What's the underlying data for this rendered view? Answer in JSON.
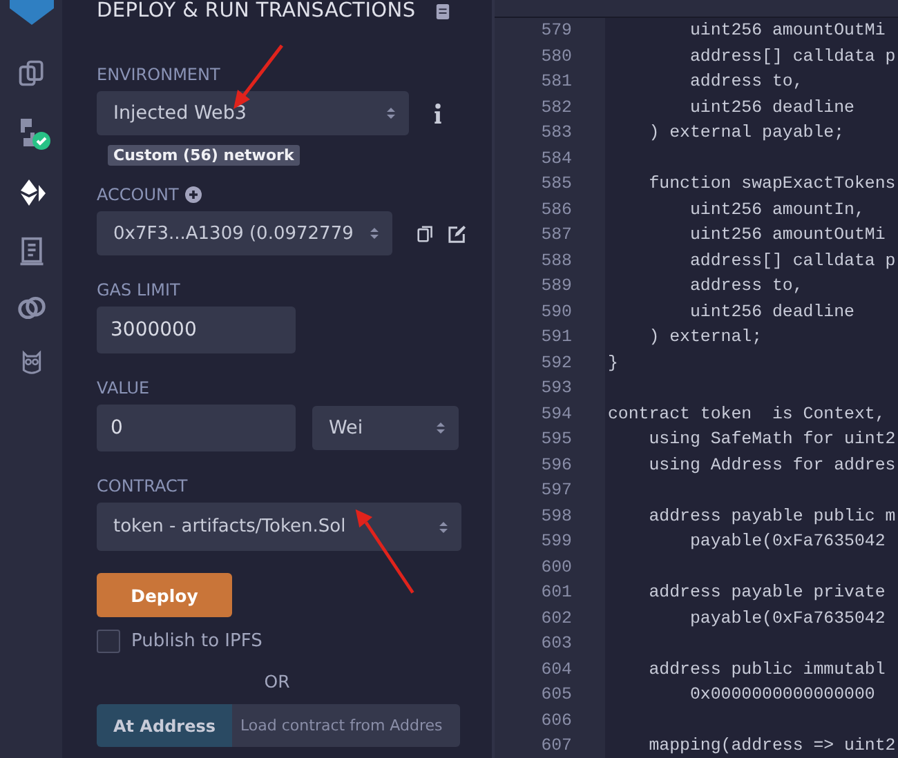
{
  "sidebar": {
    "items": [
      {
        "kind": "files",
        "selected": false
      },
      {
        "kind": "compiler",
        "selected": false,
        "badge": true
      },
      {
        "kind": "deploy",
        "selected": true
      },
      {
        "kind": "verify",
        "selected": false
      },
      {
        "kind": "link",
        "selected": false
      },
      {
        "kind": "owl",
        "selected": false
      }
    ]
  },
  "panel": {
    "title": "DEPLOY & RUN TRANSACTIONS",
    "environment": {
      "label": "ENVIRONMENT",
      "value": "Injected Web3",
      "network": "Custom (56) network"
    },
    "account": {
      "label": "ACCOUNT",
      "value": "0x7F3...A1309 (0.0972779"
    },
    "gas_limit": {
      "label": "GAS LIMIT",
      "value": "3000000"
    },
    "value": {
      "label": "VALUE",
      "amount": "0",
      "unit": "Wei"
    },
    "contract": {
      "label": "CONTRACT",
      "value": "token - artifacts/Token.Sol"
    },
    "deploy_button": "Deploy",
    "publish": {
      "label": "Publish to IPFS",
      "checked": false
    },
    "separator": "OR",
    "at_address": {
      "button": "At Address",
      "placeholder": "Load contract from Addres"
    }
  },
  "editor": {
    "lines": [
      {
        "number": "579",
        "text": "        uint256 amountOutMi"
      },
      {
        "number": "580",
        "text": "        address[] calldata p"
      },
      {
        "number": "581",
        "text": "        address to,"
      },
      {
        "number": "582",
        "text": "        uint256 deadline"
      },
      {
        "number": "583",
        "text": "    ) external payable;"
      },
      {
        "number": "584"
      },
      {
        "number": "585",
        "text": "    function swapExactTokens"
      },
      {
        "number": "586",
        "text": "        uint256 amountIn,"
      },
      {
        "number": "587",
        "text": "        uint256 amountOutMi"
      },
      {
        "number": "588",
        "text": "        address[] calldata p"
      },
      {
        "number": "589",
        "text": "        address to,"
      },
      {
        "number": "590",
        "text": "        uint256 deadline"
      },
      {
        "number": "591",
        "text": "    ) external;"
      },
      {
        "number": "592",
        "text": "}"
      },
      {
        "number": "593"
      },
      {
        "number": "594",
        "text": "contract token  is Context,"
      },
      {
        "number": "595",
        "text": "    using SafeMath for uint2"
      },
      {
        "number": "596",
        "text": "    using Address for addres"
      },
      {
        "number": "597"
      },
      {
        "number": "598",
        "text": "    address payable public m"
      },
      {
        "number": "599",
        "text": "        payable(0xFa7635042"
      },
      {
        "number": "600"
      },
      {
        "number": "601",
        "text": "    address payable private"
      },
      {
        "number": "602",
        "text": "        payable(0xFa7635042"
      },
      {
        "number": "603"
      },
      {
        "number": "604",
        "text": "    address public immutabl"
      },
      {
        "number": "605",
        "text": "        0x0000000000000000"
      },
      {
        "number": "606"
      },
      {
        "number": "607",
        "text": "    mapping(address => uint2"
      }
    ]
  }
}
